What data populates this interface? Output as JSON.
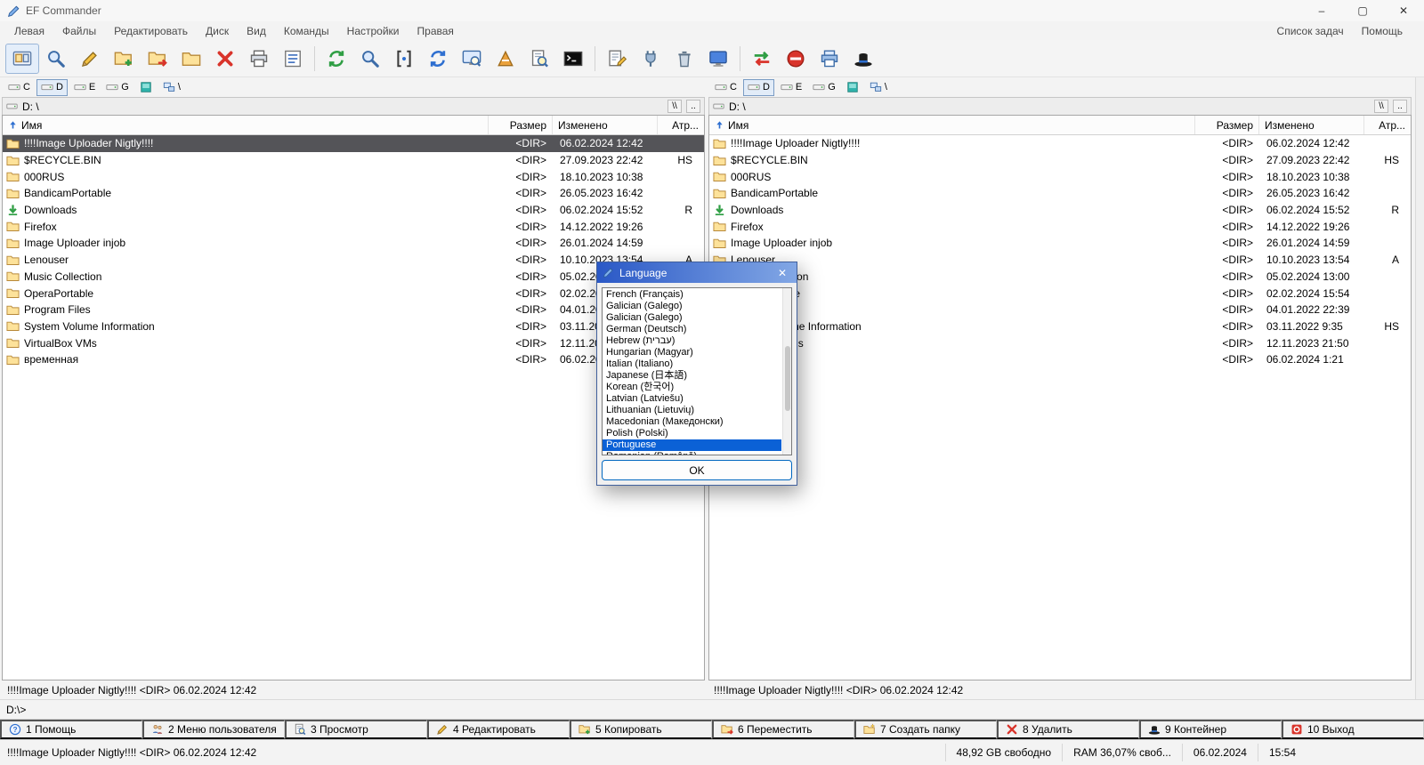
{
  "window": {
    "title": "EF Commander",
    "minimize": "–",
    "maximize": "▢",
    "close": "✕"
  },
  "menubar": {
    "items": [
      {
        "id": "left-menu",
        "label": "Левая"
      },
      {
        "id": "files",
        "label": "Файлы"
      },
      {
        "id": "edit",
        "label": "Редактировать"
      },
      {
        "id": "disk",
        "label": "Диск"
      },
      {
        "id": "view",
        "label": "Вид"
      },
      {
        "id": "commands",
        "label": "Команды"
      },
      {
        "id": "settings",
        "label": "Настройки"
      },
      {
        "id": "right-menu",
        "label": "Правая"
      }
    ],
    "right_items": [
      {
        "id": "task-list",
        "label": "Список задач"
      },
      {
        "id": "help",
        "label": "Помощь"
      }
    ]
  },
  "toolbar": {
    "items": [
      {
        "name": "panels-icon",
        "icon": "panel",
        "active": true
      },
      {
        "name": "search-icon",
        "icon": "magnifier"
      },
      {
        "name": "edit-icon",
        "icon": "pencil"
      },
      {
        "name": "copy-icon",
        "icon": "folder-plus"
      },
      {
        "name": "move-icon",
        "icon": "folder-arrow"
      },
      {
        "name": "pack-icon",
        "icon": "folder"
      },
      {
        "name": "delete-icon",
        "icon": "red-x"
      },
      {
        "name": "print-icon",
        "icon": "printer"
      },
      {
        "name": "properties-icon",
        "icon": "list"
      },
      {
        "sep": true
      },
      {
        "name": "refresh-icon",
        "icon": "arrows-green"
      },
      {
        "name": "find-icon",
        "icon": "magnifier"
      },
      {
        "name": "quick-view-icon",
        "icon": "brackets"
      },
      {
        "name": "reload-icon",
        "icon": "arrows-blue"
      },
      {
        "name": "preview-icon",
        "icon": "monitor-magnifier"
      },
      {
        "name": "chart-icon",
        "icon": "cone"
      },
      {
        "name": "find-files-icon",
        "icon": "magnifier-doc"
      },
      {
        "name": "console-icon",
        "icon": "console"
      },
      {
        "sep": true
      },
      {
        "name": "notes-icon",
        "icon": "pencil-doc"
      },
      {
        "name": "connect-icon",
        "icon": "plug"
      },
      {
        "name": "recycle-bin-icon",
        "icon": "trash"
      },
      {
        "name": "remote-desktop-icon",
        "icon": "monitor-blue"
      },
      {
        "sep": true
      },
      {
        "name": "sync-icon",
        "icon": "sync"
      },
      {
        "name": "abort-icon",
        "icon": "no-entry"
      },
      {
        "name": "device-print-icon",
        "icon": "printer-blue"
      },
      {
        "name": "container-icon",
        "icon": "hat"
      }
    ]
  },
  "drive_bar": {
    "drives": [
      "C",
      "D",
      "E",
      "G"
    ],
    "active": "D",
    "network_label": "\\"
  },
  "columns": {
    "name": "Имя",
    "size": "Размер",
    "modified": "Изменено",
    "attr": "Атр..."
  },
  "files": {
    "rows": [
      {
        "icon": "folder",
        "name": "!!!!Image Uploader Nigtly!!!!",
        "size": "<DIR>",
        "modified": "06.02.2024 12:42",
        "attr": ""
      },
      {
        "icon": "folder",
        "name": "$RECYCLE.BIN",
        "size": "<DIR>",
        "modified": "27.09.2023 22:42",
        "attr": "HS"
      },
      {
        "icon": "folder",
        "name": "000RUS",
        "size": "<DIR>",
        "modified": "18.10.2023 10:38",
        "attr": ""
      },
      {
        "icon": "folder",
        "name": "BandicamPortable",
        "size": "<DIR>",
        "modified": "26.05.2023 16:42",
        "attr": ""
      },
      {
        "icon": "download",
        "name": "Downloads",
        "size": "<DIR>",
        "modified": "06.02.2024 15:52",
        "attr": "R"
      },
      {
        "icon": "folder",
        "name": "Firefox",
        "size": "<DIR>",
        "modified": "14.12.2022 19:26",
        "attr": ""
      },
      {
        "icon": "folder",
        "name": "Image Uploader injob",
        "size": "<DIR>",
        "modified": "26.01.2024 14:59",
        "attr": ""
      },
      {
        "icon": "folder",
        "name": "Lenouser",
        "size": "<DIR>",
        "modified": "10.10.2023 13:54",
        "attr": "A"
      },
      {
        "icon": "folder",
        "name": "Music Collection",
        "size": "<DIR>",
        "modified": "05.02.2024 13:00",
        "attr": ""
      },
      {
        "icon": "folder",
        "name": "OperaPortable",
        "size": "<DIR>",
        "modified": "02.02.2024 15:54",
        "attr": ""
      },
      {
        "icon": "folder",
        "name": "Program Files",
        "size": "<DIR>",
        "modified": "04.01.2022 22:39",
        "attr": ""
      },
      {
        "icon": "folder",
        "name": "System Volume Information",
        "size": "<DIR>",
        "modified": "03.11.2022 9:35",
        "attr": "HS"
      },
      {
        "icon": "folder",
        "name": "VirtualBox VMs",
        "size": "<DIR>",
        "modified": "12.11.2023 21:50",
        "attr": ""
      },
      {
        "icon": "folder",
        "name": "временная",
        "size": "<DIR>",
        "modified": "06.02.2024 1:21",
        "attr": ""
      }
    ]
  },
  "panes": {
    "left": {
      "path": "D: \\",
      "root_btn": "\\\\",
      "up_btn": "..",
      "selected_index": 0,
      "status": "!!!!Image Uploader Nigtly!!!!   <DIR> 06.02.2024 12:42"
    },
    "right": {
      "path": "D: \\",
      "root_btn": "\\\\",
      "up_btn": "..",
      "selected_index": -1,
      "status": "!!!!Image Uploader Nigtly!!!!   <DIR> 06.02.2024 12:42"
    }
  },
  "dialog": {
    "title": "Language",
    "close": "✕",
    "items": [
      "French (Français)",
      "Galician (Galego)",
      "Galician (Galego)",
      "German (Deutsch)",
      "Hebrew (עברית)",
      "Hungarian (Magyar)",
      "Italian (Italiano)",
      "Japanese (日本語)",
      "Korean (한국어)",
      "Latvian (Latviešu)",
      "Lithuanian (Lietuvių)",
      "Macedonian (Македонски)",
      "Polish (Polski)",
      "Portuguese",
      "Romanian (Română)"
    ],
    "selected_index": 13,
    "ok_label": "OK"
  },
  "command_line": {
    "prompt": "D:\\>"
  },
  "function_bar": [
    {
      "id": "help",
      "key": "1",
      "label": "Помощь",
      "icon": "question"
    },
    {
      "id": "user-menu",
      "key": "2",
      "label": "Меню пользователя",
      "icon": "users"
    },
    {
      "id": "view",
      "key": "3",
      "label": "Просмотр",
      "icon": "magnifier-doc"
    },
    {
      "id": "edit",
      "key": "4",
      "label": "Редактировать",
      "icon": "pencil"
    },
    {
      "id": "copy",
      "key": "5",
      "label": "Копировать",
      "icon": "folder-plus"
    },
    {
      "id": "move",
      "key": "6",
      "label": "Переместить",
      "icon": "folder-arrow"
    },
    {
      "id": "mkdir",
      "key": "7",
      "label": "Создать папку",
      "icon": "newfolder"
    },
    {
      "id": "delete",
      "key": "8",
      "label": "Удалить",
      "icon": "red-x"
    },
    {
      "id": "container",
      "key": "9",
      "label": "Контейнер",
      "icon": "hat"
    },
    {
      "id": "exit",
      "key": "10",
      "label": "Выход",
      "icon": "exit"
    }
  ],
  "statusbar": {
    "selection": "!!!!Image Uploader Nigtly!!!!   <DIR> 06.02.2024 12:42",
    "free_space": "48,92 GB свободно",
    "ram": "RAM 36,07% своб...",
    "date": "06.02.2024",
    "time": "15:54"
  }
}
